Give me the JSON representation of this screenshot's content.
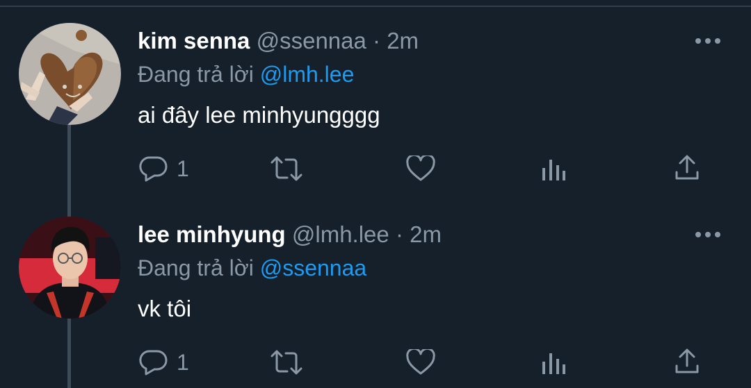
{
  "tweets": [
    {
      "display_name": "kim senna",
      "handle": "@ssennaa",
      "separator": "·",
      "time": "2m",
      "replying_prefix": "Đang trả lời",
      "replying_to": "@lmh.lee",
      "text": "ai đây lee minhyungggg",
      "reply_count": "1",
      "avatar_icon": "avatar-leaf-heart-photo"
    },
    {
      "display_name": "lee minhyung",
      "handle": "@lmh.lee",
      "separator": "·",
      "time": "2m",
      "replying_prefix": "Đang trả lời",
      "replying_to": "@ssennaa",
      "text": "vk tôi",
      "reply_count": "1",
      "avatar_icon": "avatar-person-photo"
    }
  ],
  "icons": {
    "more": "more-horizontal-icon",
    "reply": "reply-icon",
    "retweet": "retweet-icon",
    "like": "heart-icon",
    "views": "analytics-icon",
    "share": "share-icon"
  },
  "colors": {
    "background": "#15202b",
    "text": "#ffffff",
    "secondary": "#8b98a5",
    "link": "#1d9bf0"
  }
}
